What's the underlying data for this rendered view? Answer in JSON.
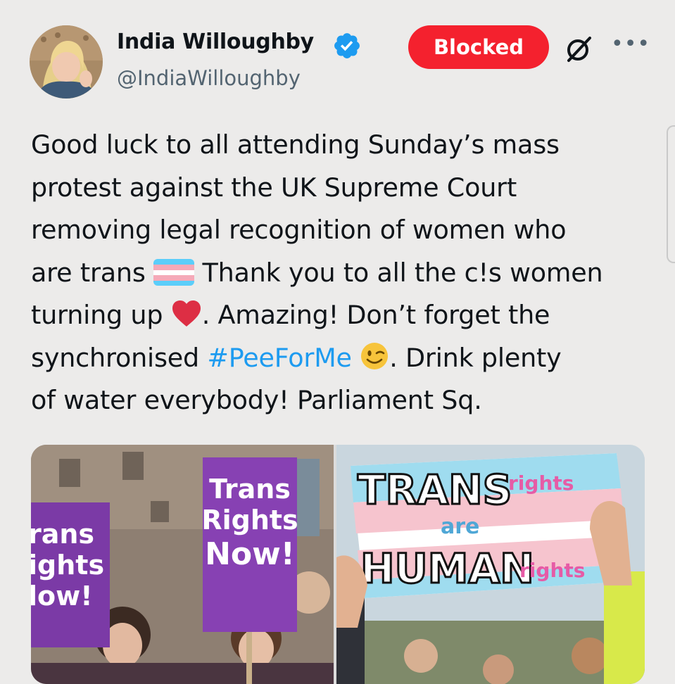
{
  "author": {
    "display_name": "India Willoughby",
    "handle": "@IndiaWilloughby",
    "verified": true
  },
  "actions": {
    "blocked_label": "Blocked",
    "grok_icon": "grok-icon",
    "more_icon": "more-icon"
  },
  "tweet": {
    "line1": "Good luck to all attending Sunday’s mass",
    "line2": "protest against the UK Supreme Court",
    "line3": "removing legal recognition of women who",
    "line4_a": "are trans ",
    "line4_b": " Thank you to all the c!s women",
    "line5_a": "turning up ",
    "line5_b": ". Amazing! Don’t forget the",
    "line6_a": "synchronised ",
    "line6_hashtag": "#PeeForMe",
    "line6_b": ". Drink plenty",
    "line7": "of water everybody! Parliament Sq.",
    "emojis": [
      "transgender-flag-icon",
      "red-heart-icon",
      "winking-face-icon"
    ]
  },
  "media": {
    "left_photo": {
      "sign_back": [
        "rans",
        "ights",
        "low!"
      ],
      "sign_front": [
        "Trans",
        "Rights",
        "Now!"
      ]
    },
    "right_photo": {
      "banner_trans": "TRANS",
      "banner_rights1": "rights",
      "banner_are": "are",
      "banner_human": "HUMAN",
      "banner_rights2": "rights"
    }
  },
  "colors": {
    "blocked_bg": "#f4212e",
    "verified": "#1d9bf0",
    "hashtag": "#1d9bf0",
    "sign_purple": "#7b3aa6",
    "trans_blue": "#5bcefa",
    "trans_pink": "#f5a9b8"
  }
}
